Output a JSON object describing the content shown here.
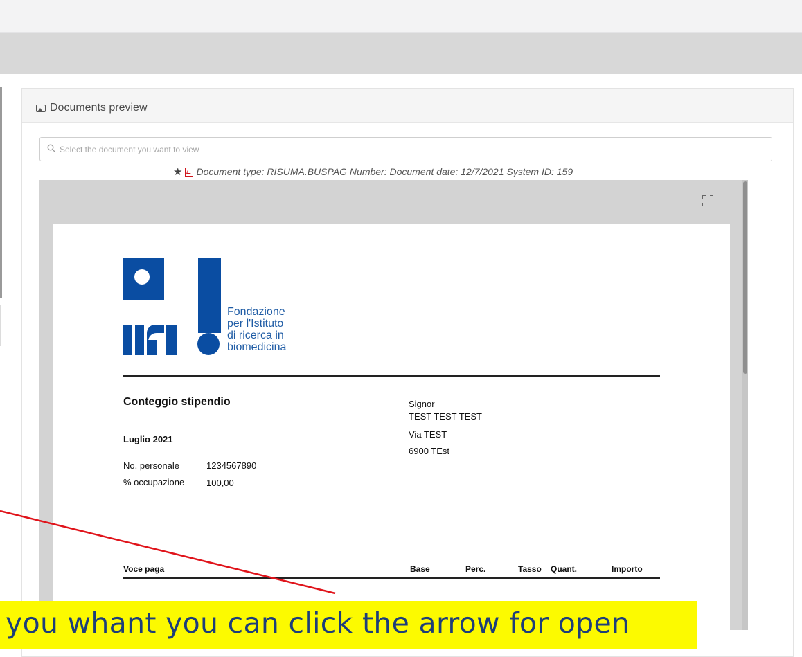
{
  "panel": {
    "title": "Documents preview",
    "icon": "image-icon"
  },
  "search": {
    "placeholder": "Select the document you want to view",
    "icon": "search-icon"
  },
  "document_meta": {
    "text": "Document type: RISUMA.BUSPAG Number: Document date: 12/7/2021 System ID: 159",
    "star_icon": "star-icon",
    "file_icon": "pdf-icon"
  },
  "viewer": {
    "fullscreen_icon": "fullscreen-icon",
    "logo": {
      "line1": "Fondazione",
      "line2": "per l'Istituto",
      "line3": "di ricerca in",
      "line4": "biomedicina",
      "color": "#0a4da2"
    },
    "payslip": {
      "title": "Conteggio stipendio",
      "period": "Luglio 2021",
      "personnel_label": "No. personale",
      "personnel_value": "1234567890",
      "occupation_label": "% occupazione",
      "occupation_value": "100,00",
      "recipient": {
        "salutation": "Signor",
        "name": "TEST TEST TEST",
        "street": "Via TEST",
        "city": "6900 TEst"
      },
      "columns": [
        "Voce paga",
        "Base",
        "Perc.",
        "Tasso",
        "Quant.",
        "Importo"
      ]
    }
  },
  "annotation": {
    "text": "you whant you can click the arrow for open",
    "background": "#fcfa00",
    "arrow_color": "#e0141b"
  }
}
